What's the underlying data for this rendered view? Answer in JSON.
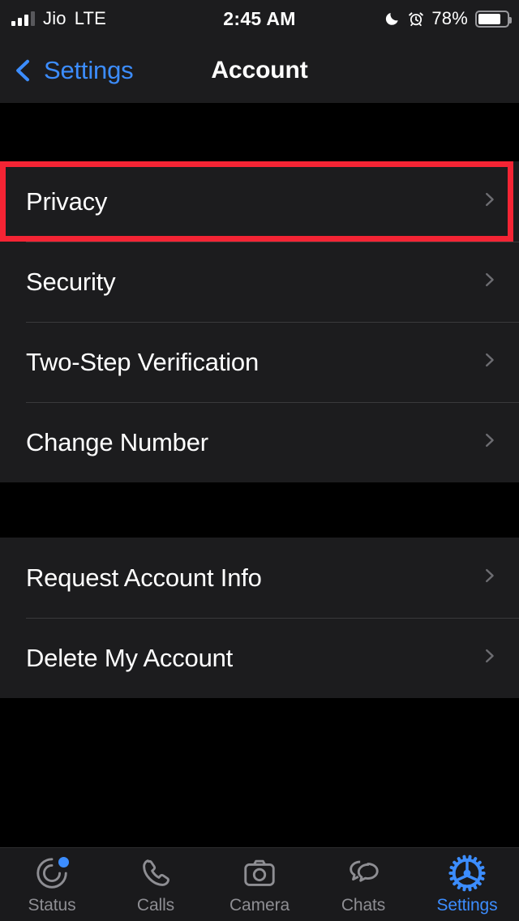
{
  "status_bar": {
    "carrier": "Jio",
    "network": "LTE",
    "time": "2:45 AM",
    "battery_percent": "78%",
    "battery_level": 78,
    "signal_bars_filled": 3,
    "signal_bars_total": 4,
    "icons": [
      "signal-bars-icon",
      "moon-dnd-icon",
      "alarm-clock-icon",
      "battery-icon"
    ]
  },
  "nav_bar": {
    "back_label": "Settings",
    "back_icon": "chevron-left-icon",
    "title": "Account"
  },
  "colors": {
    "background": "#000000",
    "row_background": "#1C1C1E",
    "separator": "#3A3A3C",
    "accent_blue": "#3C8DFF",
    "highlight_red": "#F42434",
    "label_white": "#FFFFFF",
    "muted_gray": "#8E8E93",
    "chevron_gray": "#6D6D72"
  },
  "groups": [
    {
      "id": "group1",
      "rows": [
        {
          "label": "Privacy",
          "accessory": "chevron-right-icon",
          "highlighted": true
        },
        {
          "label": "Security",
          "accessory": "chevron-right-icon",
          "highlighted": false
        },
        {
          "label": "Two-Step Verification",
          "accessory": "chevron-right-icon",
          "highlighted": false
        },
        {
          "label": "Change Number",
          "accessory": "chevron-right-icon",
          "highlighted": false
        }
      ]
    },
    {
      "id": "group2",
      "rows": [
        {
          "label": "Request Account Info",
          "accessory": "chevron-right-icon",
          "highlighted": false
        },
        {
          "label": "Delete My Account",
          "accessory": "chevron-right-icon",
          "highlighted": false
        }
      ]
    }
  ],
  "tab_bar": {
    "active_index": 4,
    "tabs": [
      {
        "label": "Status",
        "icon": "status-rings-icon",
        "badge": true,
        "active": false
      },
      {
        "label": "Calls",
        "icon": "phone-icon",
        "badge": false,
        "active": false
      },
      {
        "label": "Camera",
        "icon": "camera-icon",
        "badge": false,
        "active": false
      },
      {
        "label": "Chats",
        "icon": "chat-bubbles-icon",
        "badge": false,
        "active": false
      },
      {
        "label": "Settings",
        "icon": "gear-icon",
        "badge": false,
        "active": true
      }
    ]
  }
}
